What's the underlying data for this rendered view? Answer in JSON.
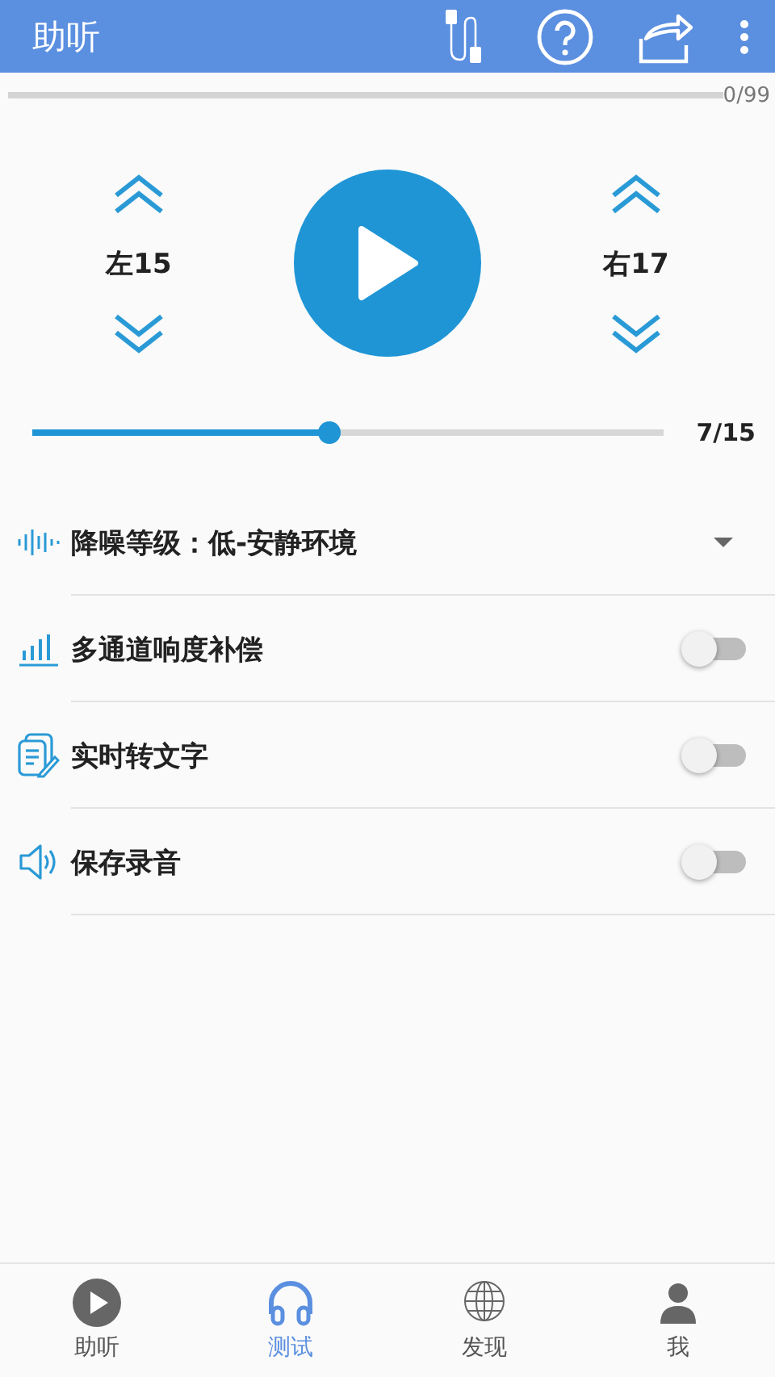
{
  "app_bar": {
    "title": "助听"
  },
  "progress": {
    "reading": "0/99"
  },
  "left": {
    "label": "左15"
  },
  "right": {
    "label": "右17"
  },
  "volume": {
    "level": 0.47,
    "reading": "7/15"
  },
  "settings": [
    {
      "kind": "dropdown",
      "label": "降噪等级：低-安静环境"
    },
    {
      "kind": "switch",
      "label": "多通道响度补偿",
      "on": false
    },
    {
      "kind": "switch",
      "label": "实时转文字",
      "on": false
    },
    {
      "kind": "switch",
      "label": "保存录音",
      "on": false
    }
  ],
  "tabs": [
    {
      "label": "助听",
      "selected": false
    },
    {
      "label": "测试",
      "selected": true
    },
    {
      "label": "发现",
      "selected": false
    },
    {
      "label": "我",
      "selected": false
    }
  ]
}
